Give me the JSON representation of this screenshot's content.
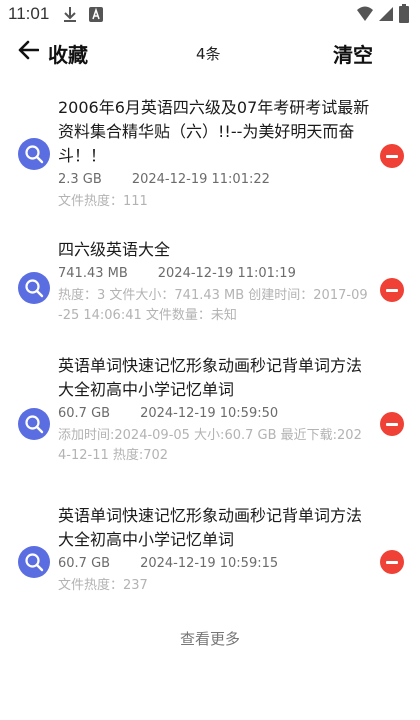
{
  "status_bar": {
    "time": "11:01",
    "icons": [
      "download-icon",
      "app-a-icon",
      "wifi-icon",
      "signal-icon",
      "battery-icon"
    ]
  },
  "header": {
    "back_icon": "back-arrow-icon",
    "title": "收藏",
    "count": "4条",
    "clear_label": "清空"
  },
  "items": [
    {
      "title": "2006年6月英语四六级及07年考研考试最新资料集合精华贴（六）!!--为美好明天而奋斗！！",
      "size": "2.3 GB",
      "date": "2024-12-19 11:01:22",
      "extra": "文件热度：111"
    },
    {
      "title": "四六级英语大全",
      "size": "741.43 MB",
      "date": "2024-12-19 11:01:19",
      "extra": "热度：3  文件大小：741.43 MB  创建时间：2017-09-25 14:06:41  文件数量：未知"
    },
    {
      "title": "英语单词快速记忆形象动画秒记背单词方法大全初高中小学记忆单词",
      "size": "60.7 GB",
      "date": "2024-12-19 10:59:50",
      "extra": " 添加时间:2024-09-05  大小:60.7 GB  最近下载:2024-12-11  热度:702"
    },
    {
      "title": "英语单词快速记忆形象动画秒记背单词方法大全初高中小学记忆单词",
      "size": "60.7 GB",
      "date": "2024-12-19 10:59:15",
      "extra": "文件热度：237"
    }
  ],
  "footer": {
    "more_label": "查看更多"
  },
  "colors": {
    "badge": "#5b6ee1",
    "remove": "#ef4135",
    "meta_text": "#6b6b6b",
    "extra_text": "#b3b3b3"
  }
}
